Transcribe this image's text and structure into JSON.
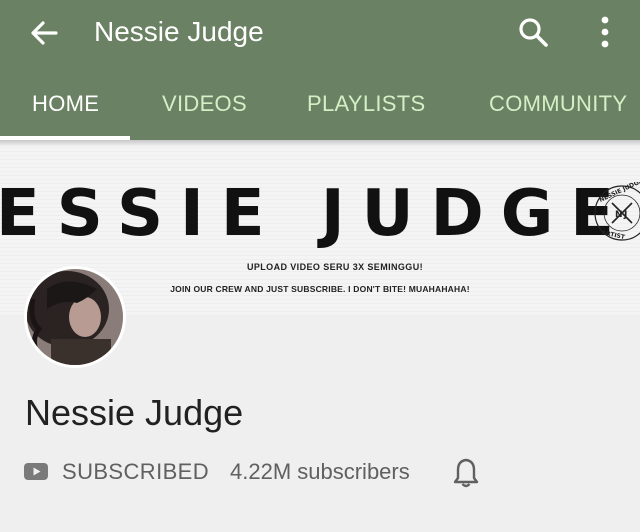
{
  "colors": {
    "app_bar": "#6b8163",
    "tab_text": "#d4efc6",
    "active_tab_text": "#ffffff"
  },
  "header": {
    "title": "Nessie Judge",
    "back_icon": "arrow-left-icon",
    "search_icon": "search-icon",
    "more_icon": "more-vertical-icon"
  },
  "tabs": [
    {
      "label": "HOME",
      "active": true
    },
    {
      "label": "VIDEOS",
      "active": false
    },
    {
      "label": "PLAYLISTS",
      "active": false
    },
    {
      "label": "COMMUNITY",
      "active": false
    }
  ],
  "banner": {
    "title": "ESSIE JUDGE",
    "line1": "UPLOAD VIDEO SERU 3X SEMINGGU!",
    "line2": "JOIN OUR CREW AND JUST SUBSCRIBE. I DON'T BITE! MUAHAHAHA!",
    "seal_text": "NESSIE JUDGE NJ ARTIST"
  },
  "channel": {
    "name": "Nessie Judge",
    "subscribe_status": "SUBSCRIBED",
    "subscriber_count": "4.22M subscribers",
    "bell_icon": "bell-icon"
  }
}
